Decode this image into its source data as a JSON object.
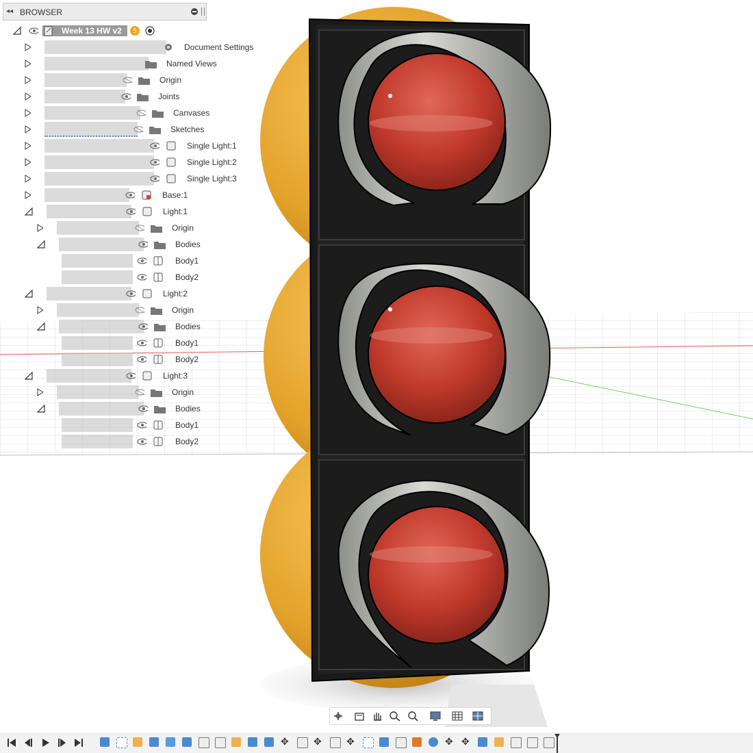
{
  "browser": {
    "title": "BROWSER",
    "root": {
      "label": "Week 13 HW v2"
    },
    "items": [
      {
        "label": "Document Settings"
      },
      {
        "label": "Named Views"
      },
      {
        "label": "Origin"
      },
      {
        "label": "Joints"
      },
      {
        "label": "Canvases"
      },
      {
        "label": "Sketches"
      },
      {
        "label": "Single Light:1"
      },
      {
        "label": "Single Light:2"
      },
      {
        "label": "Single Light:3"
      },
      {
        "label": "Base:1"
      },
      {
        "label": "Light:1"
      },
      {
        "label": "Origin"
      },
      {
        "label": "Bodies"
      },
      {
        "label": "Body1"
      },
      {
        "label": "Body2"
      },
      {
        "label": "Light:2"
      },
      {
        "label": "Origin"
      },
      {
        "label": "Bodies"
      },
      {
        "label": "Body1"
      },
      {
        "label": "Body2"
      },
      {
        "label": "Light:3"
      },
      {
        "label": "Origin"
      },
      {
        "label": "Bodies"
      },
      {
        "label": "Body1"
      },
      {
        "label": "Body2"
      }
    ]
  },
  "colors": {
    "lens_red": "#c0392b",
    "housing_black": "#1a1a1a",
    "sphere_orange": "#e3a22a",
    "visor_gray": "#b9bbb6",
    "version_badge": "#f0a61e"
  },
  "icons": {
    "nav_toolbar": [
      "orbit-icon",
      "look-at-icon",
      "pan-icon",
      "zoom-icon",
      "zoom-window-icon",
      "display-settings-icon",
      "grid-icon",
      "viewports-icon"
    ],
    "timeline": [
      "first-icon",
      "previous-icon",
      "play-icon",
      "next-icon",
      "last-icon"
    ]
  }
}
